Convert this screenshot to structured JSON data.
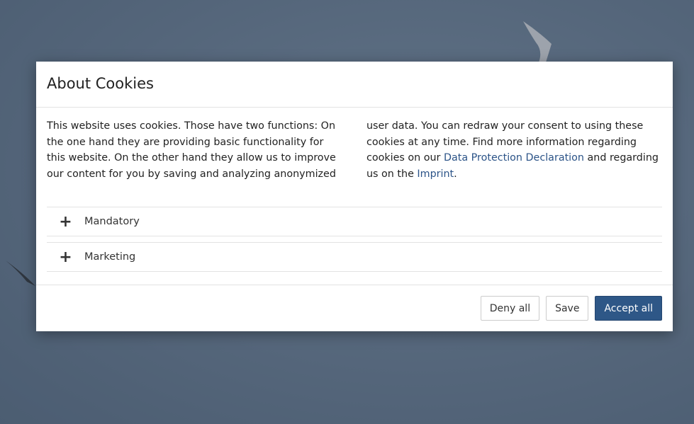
{
  "modal": {
    "title": "About Cookies",
    "intro": {
      "text_main": "This website uses cookies. Those have two functions: On the one hand they are providing basic functionality for this website. On the other hand they allow us to improve our content for you by saving and analyzing anonymized user data. You can redraw your consent to using these cookies at any time. Find more in­formation regarding cookies on our ",
      "link_privacy": "Data Protection Declaration",
      "text_middle": " and regarding us on the ",
      "link_imprint": "Imprint",
      "text_end": "."
    },
    "accordion": [
      {
        "icon": "plus-icon",
        "label": "Mandatory"
      },
      {
        "icon": "plus-icon",
        "label": "Marketing"
      }
    ],
    "buttons": {
      "deny_all": "Deny all",
      "save": "Save",
      "accept_all": "Accept all"
    }
  },
  "colors": {
    "accent": "#2e5787",
    "link": "#2b5387",
    "backdrop": "#6e8196"
  }
}
